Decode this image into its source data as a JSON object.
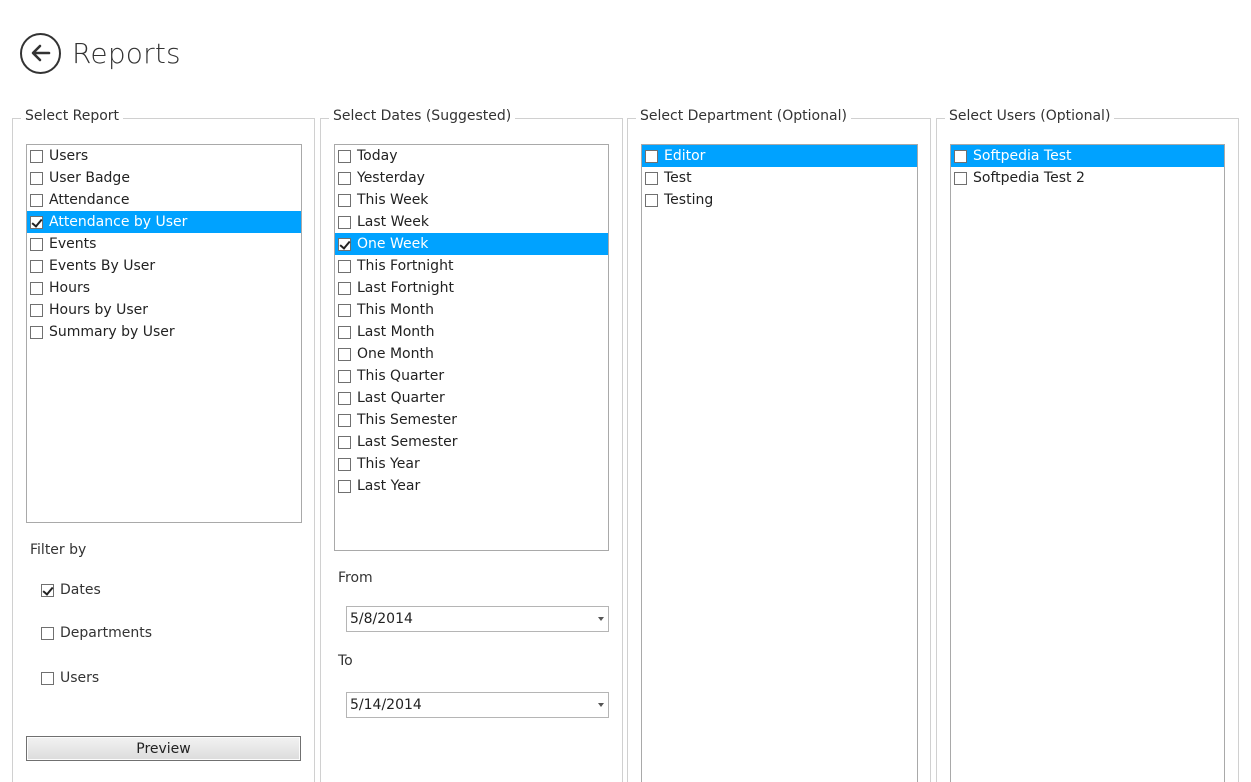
{
  "header": {
    "title": "Reports"
  },
  "report": {
    "legend": "Select Report",
    "items": [
      {
        "label": "Users",
        "checked": false,
        "selected": false
      },
      {
        "label": "User Badge",
        "checked": false,
        "selected": false
      },
      {
        "label": "Attendance",
        "checked": false,
        "selected": false
      },
      {
        "label": "Attendance by User",
        "checked": true,
        "selected": true
      },
      {
        "label": "Events",
        "checked": false,
        "selected": false
      },
      {
        "label": "Events By User",
        "checked": false,
        "selected": false
      },
      {
        "label": "Hours",
        "checked": false,
        "selected": false
      },
      {
        "label": "Hours by User",
        "checked": false,
        "selected": false
      },
      {
        "label": "Summary by User",
        "checked": false,
        "selected": false
      }
    ],
    "filter_label": "Filter by",
    "filters": [
      {
        "label": "Dates",
        "checked": true
      },
      {
        "label": "Departments",
        "checked": false
      },
      {
        "label": "Users",
        "checked": false
      }
    ],
    "preview_label": "Preview"
  },
  "dates": {
    "legend": "Select Dates (Suggested)",
    "items": [
      {
        "label": "Today",
        "checked": false,
        "selected": false
      },
      {
        "label": "Yesterday",
        "checked": false,
        "selected": false
      },
      {
        "label": "This Week",
        "checked": false,
        "selected": false
      },
      {
        "label": "Last Week",
        "checked": false,
        "selected": false
      },
      {
        "label": "One Week",
        "checked": true,
        "selected": true
      },
      {
        "label": "This Fortnight",
        "checked": false,
        "selected": false
      },
      {
        "label": "Last Fortnight",
        "checked": false,
        "selected": false
      },
      {
        "label": "This Month",
        "checked": false,
        "selected": false
      },
      {
        "label": "Last Month",
        "checked": false,
        "selected": false
      },
      {
        "label": "One Month",
        "checked": false,
        "selected": false
      },
      {
        "label": "This Quarter",
        "checked": false,
        "selected": false
      },
      {
        "label": "Last Quarter",
        "checked": false,
        "selected": false
      },
      {
        "label": "This Semester",
        "checked": false,
        "selected": false
      },
      {
        "label": "Last Semester",
        "checked": false,
        "selected": false
      },
      {
        "label": "This Year",
        "checked": false,
        "selected": false
      },
      {
        "label": "Last Year",
        "checked": false,
        "selected": false
      }
    ],
    "from_label": "From",
    "from_value": "5/8/2014",
    "to_label": "To",
    "to_value": "5/14/2014"
  },
  "department": {
    "legend": "Select Department (Optional)",
    "items": [
      {
        "label": "Editor",
        "checked": false,
        "selected": true
      },
      {
        "label": "Test",
        "checked": false,
        "selected": false
      },
      {
        "label": "Testing",
        "checked": false,
        "selected": false
      }
    ]
  },
  "users": {
    "legend": "Select Users (Optional)",
    "items": [
      {
        "label": "Softpedia Test",
        "checked": false,
        "selected": true
      },
      {
        "label": "Softpedia Test 2",
        "checked": false,
        "selected": false
      }
    ]
  },
  "icons": {
    "back": "back-arrow-icon",
    "checkbox": "checkbox-icon",
    "dropdown": "chevron-down-icon"
  },
  "colors": {
    "selection": "#00a2ff",
    "border": "#a9a9a9"
  }
}
